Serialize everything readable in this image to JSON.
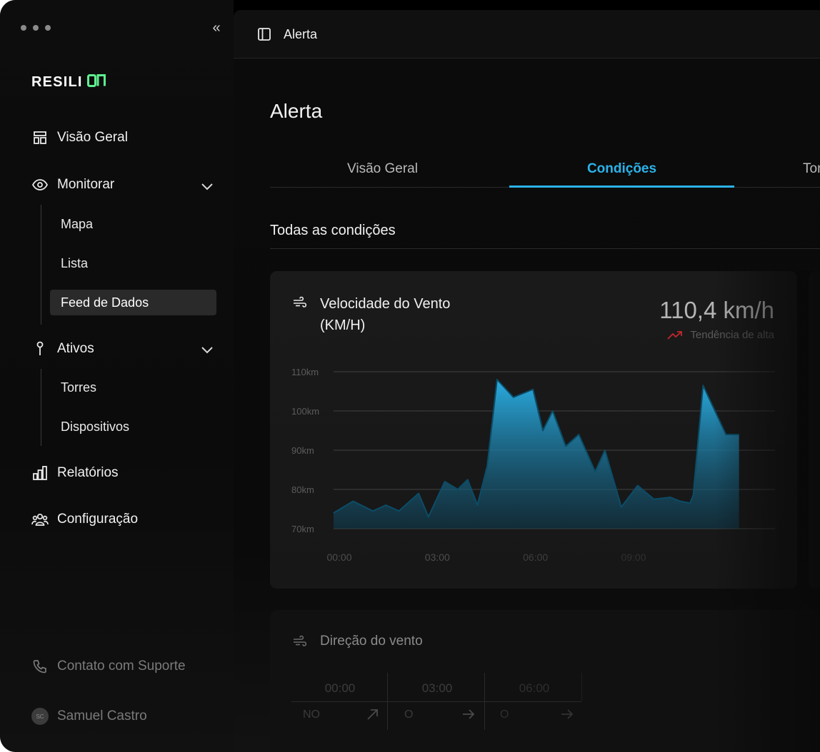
{
  "app": {
    "brand_prefix": "RESILI",
    "brand_suffix": "ON"
  },
  "sidebar": {
    "nav": [
      {
        "label": "Visão Geral",
        "icon": "layout-icon"
      },
      {
        "label": "Monitorar",
        "icon": "eye-icon"
      },
      {
        "label": "Ativos",
        "icon": "pin-icon"
      },
      {
        "label": "Relatórios",
        "icon": "bar-chart-icon"
      },
      {
        "label": "Configuração",
        "icon": "users-icon"
      }
    ],
    "monitor_sub": [
      "Mapa",
      "Lista",
      "Feed de Dados"
    ],
    "assets_sub": [
      "Torres",
      "Dispositivos"
    ],
    "support_label": "Contato com Suporte",
    "user_name": "Samuel Castro",
    "user_initials": "SC"
  },
  "topbar": {
    "title": "Alerta"
  },
  "page": {
    "title": "Alerta",
    "tabs": [
      "Visão Geral",
      "Condições",
      "Tor"
    ],
    "active_tab": "Condições",
    "section_title": "Todas as condições"
  },
  "wind_card": {
    "title_line1": "Velocidade do Vento",
    "title_line2": "(KM/H)",
    "value": "110,4 km/h",
    "trend_label": "Tendência de alta",
    "trend_color": "#c0282d",
    "accent": "#2bb3ea"
  },
  "direction_card": {
    "title": "Direção do vento",
    "columns": [
      {
        "time": "00:00",
        "value": "NO",
        "arrow": "north-east-arrow-icon"
      },
      {
        "time": "03:00",
        "value": "O",
        "arrow": "east-arrow-icon"
      },
      {
        "time": "06:00",
        "value": "O",
        "arrow": "east-arrow-icon"
      }
    ]
  },
  "chart_data": {
    "type": "area",
    "title": "Velocidade do Vento (KM/H)",
    "xlabel": "",
    "ylabel": "",
    "y_ticks": [
      "70km",
      "80km",
      "90km",
      "100km",
      "110km"
    ],
    "y_tick_values": [
      70,
      80,
      90,
      100,
      110
    ],
    "x_ticks": [
      "00:00",
      "03:00",
      "06:00",
      "09:00"
    ],
    "x_tick_values": [
      0,
      3,
      6,
      9
    ],
    "ylim": [
      70,
      110
    ],
    "xlim": [
      0,
      13.5
    ],
    "grid": true,
    "series": [
      {
        "x": [
          0,
          0.6,
          1.2,
          1.6,
          2.0,
          2.6,
          2.9,
          3.4,
          3.8,
          4.1,
          4.4,
          4.7,
          5.0,
          5.5,
          6.1,
          6.4,
          6.7,
          7.1,
          7.5,
          8.0,
          8.3,
          8.8,
          9.3,
          9.8,
          10.3,
          10.6,
          10.9,
          11.0,
          11.3,
          12.0,
          12.4
        ],
        "values": [
          74,
          77,
          74.5,
          76,
          74.5,
          79,
          73,
          82,
          80,
          82.5,
          76,
          86,
          108,
          103.5,
          105.5,
          95,
          100,
          91,
          94,
          84.5,
          90,
          75.5,
          81,
          77.5,
          78,
          77,
          76.5,
          78.5,
          106.5,
          94,
          94
        ]
      }
    ]
  }
}
